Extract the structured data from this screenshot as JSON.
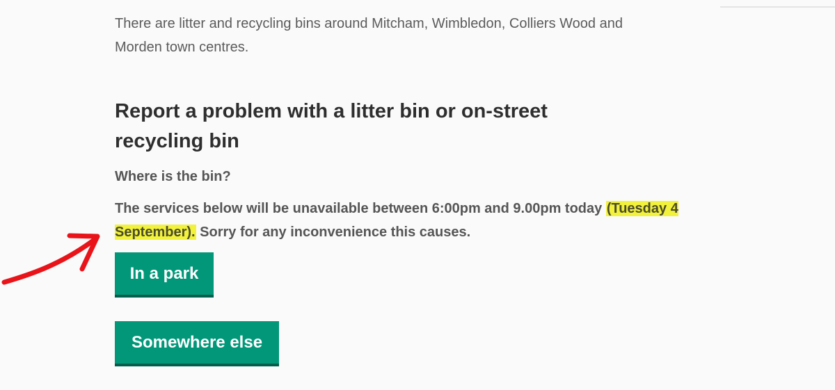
{
  "intro": {
    "text": "There are litter and recycling bins around Mitcham, Wimbledon, Colliers Wood and Morden town centres."
  },
  "heading": "Report a problem with a litter bin or on-street recycling bin",
  "question": "Where is the bin?",
  "notice": {
    "before": "The services below will be unavailable between 6:00pm and 9.00pm today ",
    "highlighted": "(Tuesday 4 September).",
    "after": " Sorry for any inconvenience this causes."
  },
  "buttons": {
    "park": "In a park",
    "elsewhere": "Somewhere else"
  },
  "colors": {
    "button": "#039779",
    "button_border": "#005e4c",
    "highlight": "#f2f23c",
    "annotation_arrow": "#e8141a"
  }
}
